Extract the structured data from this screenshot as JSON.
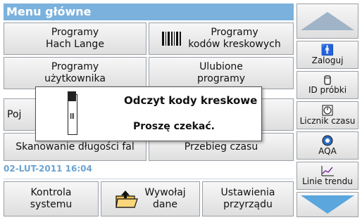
{
  "header": {
    "title": "Menu główne"
  },
  "main_buttons": {
    "hach_lange": "Programy\nHach Lange",
    "barcode": "Programy\nkodów kreskowych",
    "user_programs": "Programy\nużytkownika",
    "favorites": "Ulubione\nprogramy",
    "single_wavelength": "Poj",
    "wavelength_scan": "Skanowanie długości fal",
    "time_course": "Przebieg czasu"
  },
  "status": {
    "datetime": "02-LUT-2011 16:04"
  },
  "bottom": {
    "system_check": "Kontrola\nsystemu",
    "recall_data": "Wywołaj\ndane",
    "instrument_setup": "Ustawienia\nprzyrządu"
  },
  "right_panel": {
    "login": "Zaloguj",
    "sample_id": "ID próbki",
    "timer": "Licznik czasu",
    "aqa": "AQA",
    "trend_lines": "Linie trendu"
  },
  "dialog": {
    "title": "Odczyt kody kreskowe",
    "message": "Proszę czekać."
  },
  "icons": {
    "login": "person-icon",
    "sample_id": "cylinder-icon",
    "timer": "timer-icon",
    "aqa": "aqa-icon",
    "trend_lines": "trend-chart-icon",
    "barcode": "barcode-icon",
    "folder": "folder-icon"
  },
  "colors": {
    "title_bar": "#7ab1dd",
    "scroll_up": "#9fb4c6",
    "scroll_down": "#5aa6dd",
    "datetime": "#6aa3d2"
  }
}
